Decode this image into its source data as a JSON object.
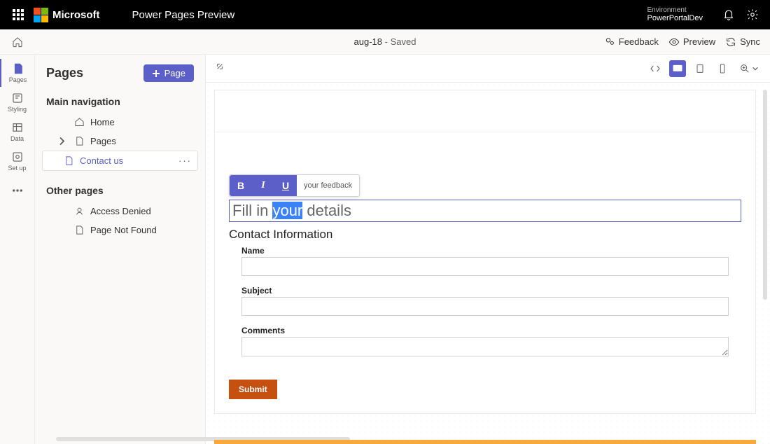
{
  "topbar": {
    "brand": "Microsoft",
    "product": "Power Pages Preview",
    "env_label": "Environment",
    "env_name": "PowerPortalDev"
  },
  "subbar": {
    "doc_name": "aug-18",
    "status": "Saved",
    "feedback": "Feedback",
    "preview": "Preview",
    "sync": "Sync"
  },
  "rail": {
    "pages": "Pages",
    "styling": "Styling",
    "data": "Data",
    "setup": "Set up"
  },
  "sidebar": {
    "title": "Pages",
    "add_btn": "Page",
    "main_nav": "Main navigation",
    "items_main": {
      "home": "Home",
      "pages": "Pages",
      "contact": "Contact us"
    },
    "other_hdr": "Other pages",
    "items_other": {
      "access_denied": "Access Denied",
      "not_found": "Page Not Found"
    },
    "ellipsis": "···"
  },
  "editor": {
    "crumb_suffix": "your feedback",
    "heading_pre": "Fill in ",
    "heading_sel": "your",
    "heading_post": " details",
    "section": "Contact Information",
    "fields": {
      "name": "Name",
      "subject": "Subject",
      "comments": "Comments"
    },
    "submit": "Submit",
    "fmt": {
      "b": "B",
      "i": "I",
      "u": "U"
    }
  }
}
